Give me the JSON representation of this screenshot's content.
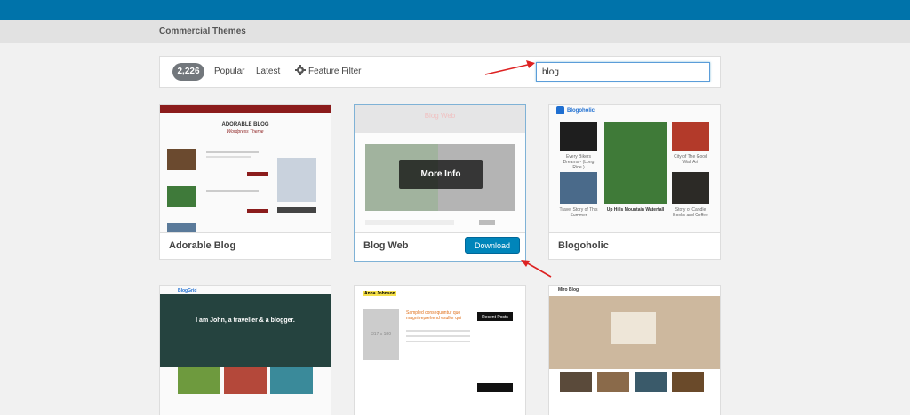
{
  "header": {
    "section_title": "Commercial Themes"
  },
  "filter": {
    "count": "2,226",
    "tabs": [
      "Popular",
      "Latest"
    ],
    "feature_filter": "Feature Filter",
    "search_value": "blog"
  },
  "themes": [
    {
      "name": "Adorable Blog",
      "preview_title": "ADORABLE BLOG",
      "preview_tagline": "Wordpress Theme"
    },
    {
      "name": "Blog Web",
      "hover_action": "More Info",
      "download_label": "Download",
      "preview_title": "Blog Web"
    },
    {
      "name": "Blogoholic",
      "preview_title": "Blogoholic",
      "captions": [
        "Every Bikers Dreams - (Long Ride )",
        "City of The Good Wall Art",
        "Up Hills Mountain Waterfall",
        "Travel Story of This Summer",
        "Story of Candle Books and Coffee"
      ]
    },
    {
      "name": "",
      "preview_title": "BlogGrid",
      "hero": "I am John, a traveller & a blogger."
    },
    {
      "name": "",
      "preview_title": "Anna Johnson",
      "placeholder": "317 x 180",
      "post_title": "Sampled consequuntur quo magni reprehend esullor qui",
      "recent": "Recent Posts"
    },
    {
      "name": "",
      "preview_title": "Miro Blog"
    }
  ],
  "colors": {
    "wp_blue": "#0073aa",
    "button_blue": "#0085ba",
    "arrow_red": "#dd2222"
  }
}
